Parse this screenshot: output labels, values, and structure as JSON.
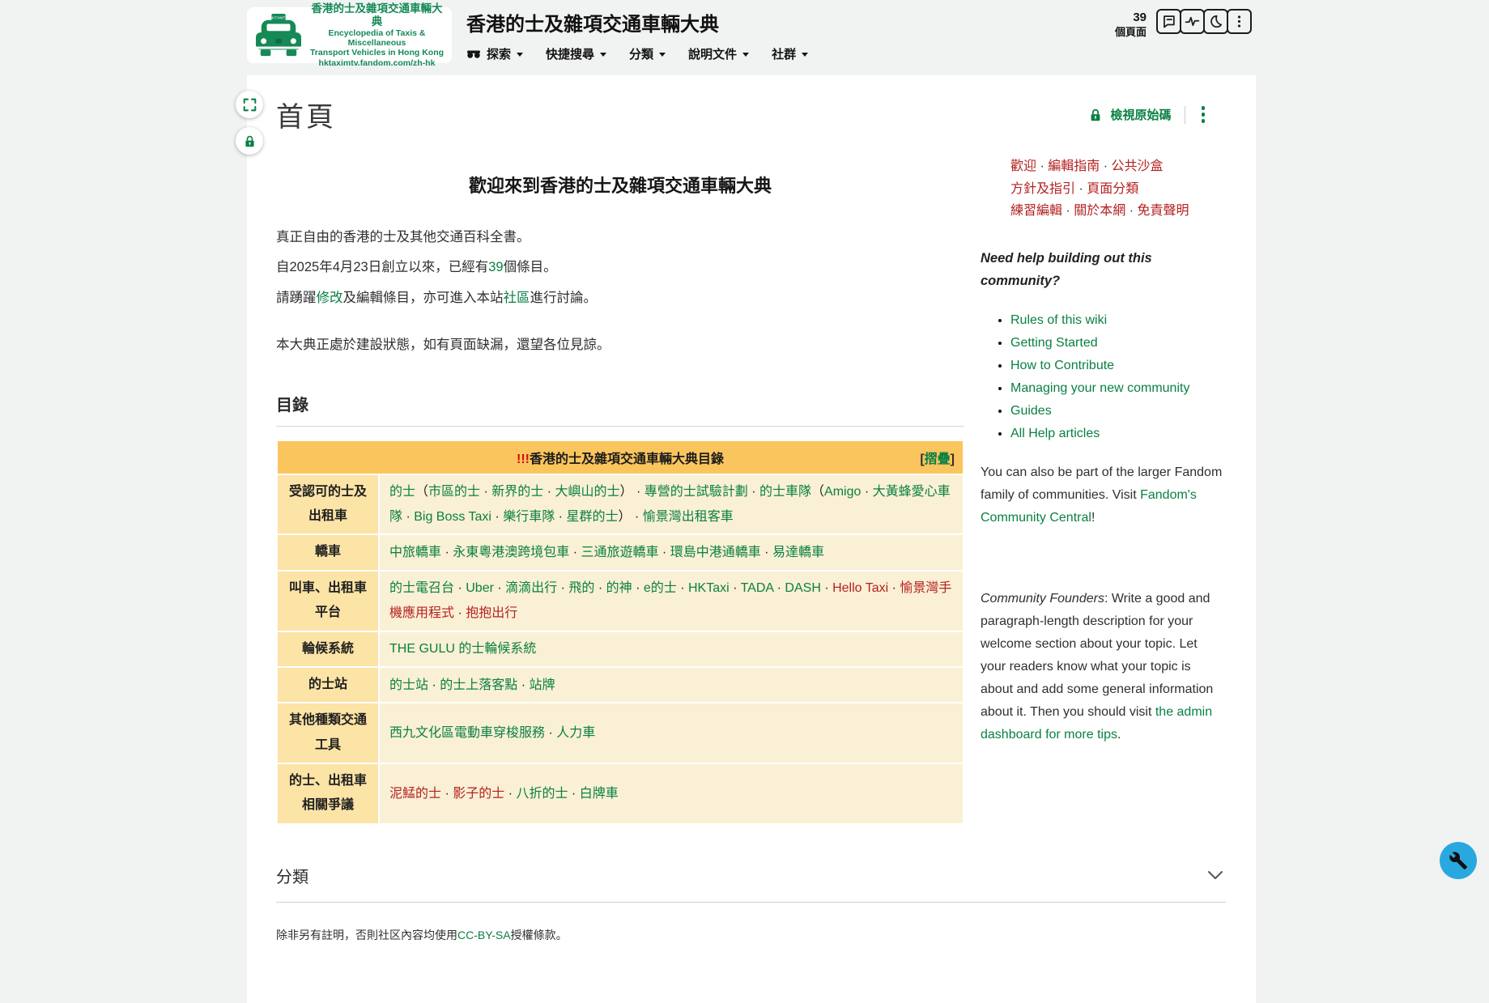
{
  "colors": {
    "accent_green": "#0a8043",
    "logo_green": "#158a57",
    "red_link": "#b42121",
    "toc_header_bg": "#fbc55d",
    "toc_label_bg": "#fce3a6",
    "toc_cell_bg": "#faf0d5",
    "page_bg": "#f1f2f2",
    "fab_blue": "#29a8e0"
  },
  "header": {
    "site_title": "香港的士及雜項交通車輛大典",
    "logo": {
      "line1": "香港的士及雜項交通車輛大典",
      "line2": "Encyclopedia of Taxis & Miscellaneous",
      "line3": "Transport Vehicles in Hong Kong",
      "line4": "hktaximtv.fandom.com/zh-hk"
    },
    "nav": [
      {
        "label": "探索"
      },
      {
        "label": "快捷搜尋"
      },
      {
        "label": "分類"
      },
      {
        "label": "說明文件"
      },
      {
        "label": "社群"
      }
    ],
    "page_count": {
      "number": "39",
      "unit": "個頁面"
    }
  },
  "article": {
    "title": "首頁",
    "view_source_label": "檢視原始碼",
    "welcome_heading": "歡迎來到香港的士及雜項交通車輛大典",
    "paragraphs": [
      [
        {
          "t": "真正自由的香港的士及其他交通百科全書。",
          "c": "p"
        }
      ],
      [
        {
          "t": "自2025年4月23日創立以來，已經有",
          "c": "p"
        },
        {
          "t": "39",
          "c": "g"
        },
        {
          "t": "個條目。",
          "c": "p"
        }
      ],
      [
        {
          "t": "請踴躍",
          "c": "p"
        },
        {
          "t": "修改",
          "c": "g"
        },
        {
          "t": "及編輯條目，亦可進入本站",
          "c": "p"
        },
        {
          "t": "社區",
          "c": "g"
        },
        {
          "t": "進行討論。",
          "c": "p"
        }
      ],
      [
        {
          "t": "本大典正處於建設狀態，如有頁面缺漏，還望各位見諒。",
          "c": "p"
        }
      ]
    ]
  },
  "toc": {
    "section_heading": "目錄",
    "title_bang": "!!!",
    "title_text": "香港的士及雜項交通車輛大典目錄",
    "collapse": [
      {
        "t": "[",
        "c": "p"
      },
      {
        "t": "摺疊",
        "c": "g"
      },
      {
        "t": "]",
        "c": "p"
      }
    ],
    "rows": [
      {
        "label": "受認可的士及出租車",
        "segments": [
          {
            "t": "的士",
            "c": "g"
          },
          {
            "t": "（",
            "c": "p"
          },
          {
            "t": "市區的士",
            "c": "g"
          },
          {
            "t": " · ",
            "c": "p"
          },
          {
            "t": "新界的士",
            "c": "g"
          },
          {
            "t": " · ",
            "c": "p"
          },
          {
            "t": "大嶼山的士",
            "c": "g"
          },
          {
            "t": "） · ",
            "c": "p"
          },
          {
            "t": "專營的士試驗計劃",
            "c": "g"
          },
          {
            "t": " · ",
            "c": "p"
          },
          {
            "t": "的士車隊",
            "c": "g"
          },
          {
            "t": "（",
            "c": "p"
          },
          {
            "t": "Amigo",
            "c": "g"
          },
          {
            "t": " · ",
            "c": "p"
          },
          {
            "t": "大黃蜂愛心車隊",
            "c": "g"
          },
          {
            "t": " · ",
            "c": "p"
          },
          {
            "t": "Big Boss Taxi",
            "c": "g"
          },
          {
            "t": " · ",
            "c": "p"
          },
          {
            "t": "樂行車隊",
            "c": "g"
          },
          {
            "t": " · ",
            "c": "p"
          },
          {
            "t": "星群的士",
            "c": "g"
          },
          {
            "t": "） · ",
            "c": "p"
          },
          {
            "t": "愉景灣出租客車",
            "c": "g"
          }
        ]
      },
      {
        "label": "轎車",
        "segments": [
          {
            "t": "中旅轎車",
            "c": "g"
          },
          {
            "t": " · ",
            "c": "p"
          },
          {
            "t": "永東粵港澳跨境包車",
            "c": "g"
          },
          {
            "t": " · ",
            "c": "p"
          },
          {
            "t": "三通旅遊轎車",
            "c": "g"
          },
          {
            "t": " · ",
            "c": "p"
          },
          {
            "t": "環島中港通轎車",
            "c": "g"
          },
          {
            "t": " · ",
            "c": "p"
          },
          {
            "t": "易達轎車",
            "c": "g"
          }
        ]
      },
      {
        "label": "叫車、出租車平台",
        "segments": [
          {
            "t": "的士電召台",
            "c": "g"
          },
          {
            "t": " · ",
            "c": "p"
          },
          {
            "t": "Uber",
            "c": "g"
          },
          {
            "t": " · ",
            "c": "p"
          },
          {
            "t": "滴滴出行",
            "c": "g"
          },
          {
            "t": " · ",
            "c": "p"
          },
          {
            "t": "飛的",
            "c": "g"
          },
          {
            "t": " · ",
            "c": "p"
          },
          {
            "t": "的神",
            "c": "g"
          },
          {
            "t": " · ",
            "c": "p"
          },
          {
            "t": "e的士",
            "c": "g"
          },
          {
            "t": " · ",
            "c": "p"
          },
          {
            "t": "HKTaxi",
            "c": "g"
          },
          {
            "t": " · ",
            "c": "p"
          },
          {
            "t": "TADA",
            "c": "g"
          },
          {
            "t": " · ",
            "c": "p"
          },
          {
            "t": "DASH",
            "c": "g"
          },
          {
            "t": " · ",
            "c": "p"
          },
          {
            "t": "Hello Taxi",
            "c": "r"
          },
          {
            "t": " · ",
            "c": "p"
          },
          {
            "t": "愉景灣手機應用程式",
            "c": "r"
          },
          {
            "t": " · ",
            "c": "p"
          },
          {
            "t": "抱抱出行",
            "c": "r"
          }
        ]
      },
      {
        "label": "輪候系統",
        "segments": [
          {
            "t": "THE GULU 的士輪候系統",
            "c": "g"
          }
        ]
      },
      {
        "label": "的士站",
        "segments": [
          {
            "t": "的士站",
            "c": "g"
          },
          {
            "t": " · ",
            "c": "p"
          },
          {
            "t": "的士上落客點",
            "c": "g"
          },
          {
            "t": " · ",
            "c": "p"
          },
          {
            "t": "站牌",
            "c": "g"
          }
        ]
      },
      {
        "label": "其他種類交通工具",
        "segments": [
          {
            "t": "西九文化區電動車穿梭服務",
            "c": "g"
          },
          {
            "t": " · ",
            "c": "p"
          },
          {
            "t": "人力車",
            "c": "g"
          }
        ]
      },
      {
        "label": "的士、出租車相關爭議",
        "segments": [
          {
            "t": "泥鯭的士",
            "c": "r"
          },
          {
            "t": " · ",
            "c": "p"
          },
          {
            "t": "影子的士",
            "c": "r"
          },
          {
            "t": " · ",
            "c": "p"
          },
          {
            "t": "八折的士",
            "c": "g"
          },
          {
            "t": " · ",
            "c": "p"
          },
          {
            "t": "白牌車",
            "c": "g"
          }
        ]
      }
    ]
  },
  "sidebar": {
    "red_rows": [
      [
        {
          "t": "歡迎",
          "c": "r"
        },
        {
          "t": " · ",
          "c": "p"
        },
        {
          "t": "編輯指南",
          "c": "r"
        },
        {
          "t": " · ",
          "c": "p"
        },
        {
          "t": "公共沙盒",
          "c": "r"
        }
      ],
      [
        {
          "t": "方針及指引",
          "c": "r"
        },
        {
          "t": " · ",
          "c": "p"
        },
        {
          "t": "頁面分類",
          "c": "r"
        }
      ],
      [
        {
          "t": "練習編輯",
          "c": "r"
        },
        {
          "t": " · ",
          "c": "p"
        },
        {
          "t": "關於本網",
          "c": "r"
        },
        {
          "t": " · ",
          "c": "p"
        },
        {
          "t": "免責聲明",
          "c": "r"
        }
      ]
    ],
    "question": "Need help building out this community?",
    "help_links": [
      "Rules of this wiki",
      "Getting Started",
      "How to Contribute",
      "Managing your new community",
      "Guides",
      "All Help articles"
    ],
    "para1": [
      {
        "t": "You can also be part of the larger Fandom family of communities. Visit ",
        "c": "p"
      },
      {
        "t": "Fandom's Community Central",
        "c": "g"
      },
      {
        "t": "!",
        "c": "p"
      }
    ],
    "para2": [
      {
        "t": "Community Founders",
        "c": "pi"
      },
      {
        "t": ": Write a good and paragraph-length description for your welcome section about your topic. Let your readers know what your topic is about and add some general information about it. Then you should visit ",
        "c": "p"
      },
      {
        "t": "the admin dashboard for more tips",
        "c": "g"
      },
      {
        "t": ".",
        "c": "p"
      }
    ]
  },
  "categories": {
    "heading": "分類"
  },
  "footer": {
    "license": [
      {
        "t": "除非另有註明，否則社区內容均使用",
        "c": "p"
      },
      {
        "t": "CC-BY-SA",
        "c": "g"
      },
      {
        "t": "授權條款。",
        "c": "p"
      }
    ]
  }
}
